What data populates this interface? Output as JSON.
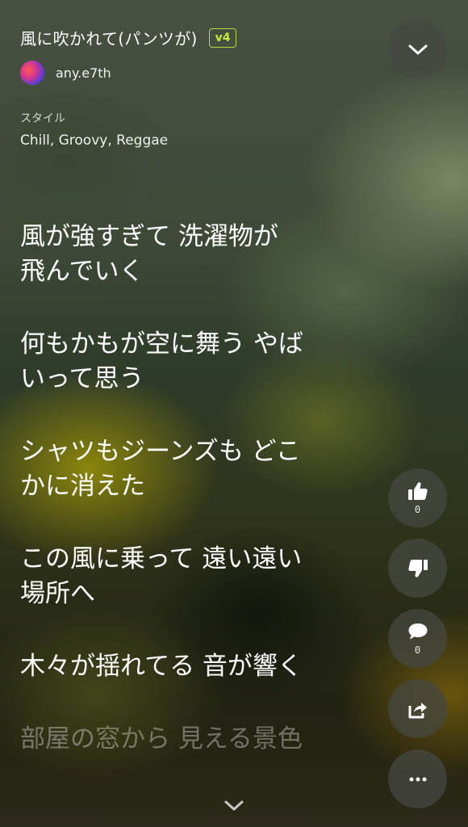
{
  "song": {
    "title": "風に吹かれて(パンツが)",
    "version": "v4",
    "artist": "any.e7th"
  },
  "style": {
    "label": "スタイル",
    "value": "Chill, Groovy, Reggae"
  },
  "lyrics": [
    "風が強すぎて 洗濯物が 飛んでいく",
    "何もかもが空に舞う やばいって思う",
    "シャツもジーンズも どこかに消えた",
    "この風に乗って 遠い遠い場所へ",
    "木々が揺れてる 音が響く",
    "部屋の窓から 見える景色"
  ],
  "actions": {
    "like_count": "0",
    "comment_count": "0"
  },
  "icons": {
    "collapse": "chevron-down-icon",
    "like": "thumbs-up-icon",
    "dislike": "thumbs-down-icon",
    "comment": "comment-icon",
    "share": "share-icon",
    "more": "more-icon",
    "scroll": "chevron-down-icon"
  },
  "colors": {
    "badge": "#c6ec3a"
  }
}
